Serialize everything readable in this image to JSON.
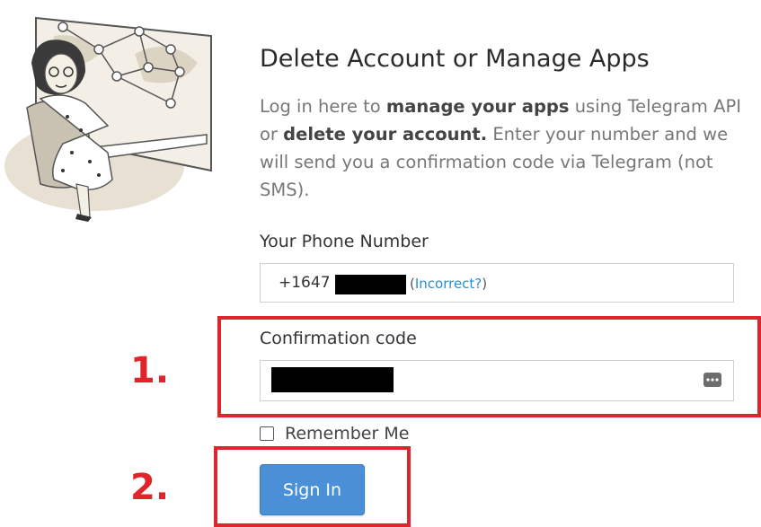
{
  "page": {
    "title": "Delete Account or Manage Apps",
    "description": {
      "part1": "Log in here to ",
      "bold1": "manage your apps",
      "part2": " using Telegram API or ",
      "bold2": "delete your account.",
      "part3": " Enter your number and we will send you a confirmation code via Telegram (not SMS)."
    }
  },
  "phone": {
    "label": "Your Phone Number",
    "prefix": "+1647",
    "incorrect_open": "(",
    "incorrect_link": "Incorrect?",
    "incorrect_close": ")"
  },
  "confirmation": {
    "label": "Confirmation code",
    "input_icon": "keyboard-dots-icon"
  },
  "remember": {
    "label": "Remember Me",
    "checked": false
  },
  "signin": {
    "label": "Sign In"
  },
  "annotations": {
    "step1": "1.",
    "step2": "2."
  },
  "colors": {
    "accent": "#4b8fd6",
    "link": "#2a8dd4",
    "highlight": "#e0242c"
  }
}
